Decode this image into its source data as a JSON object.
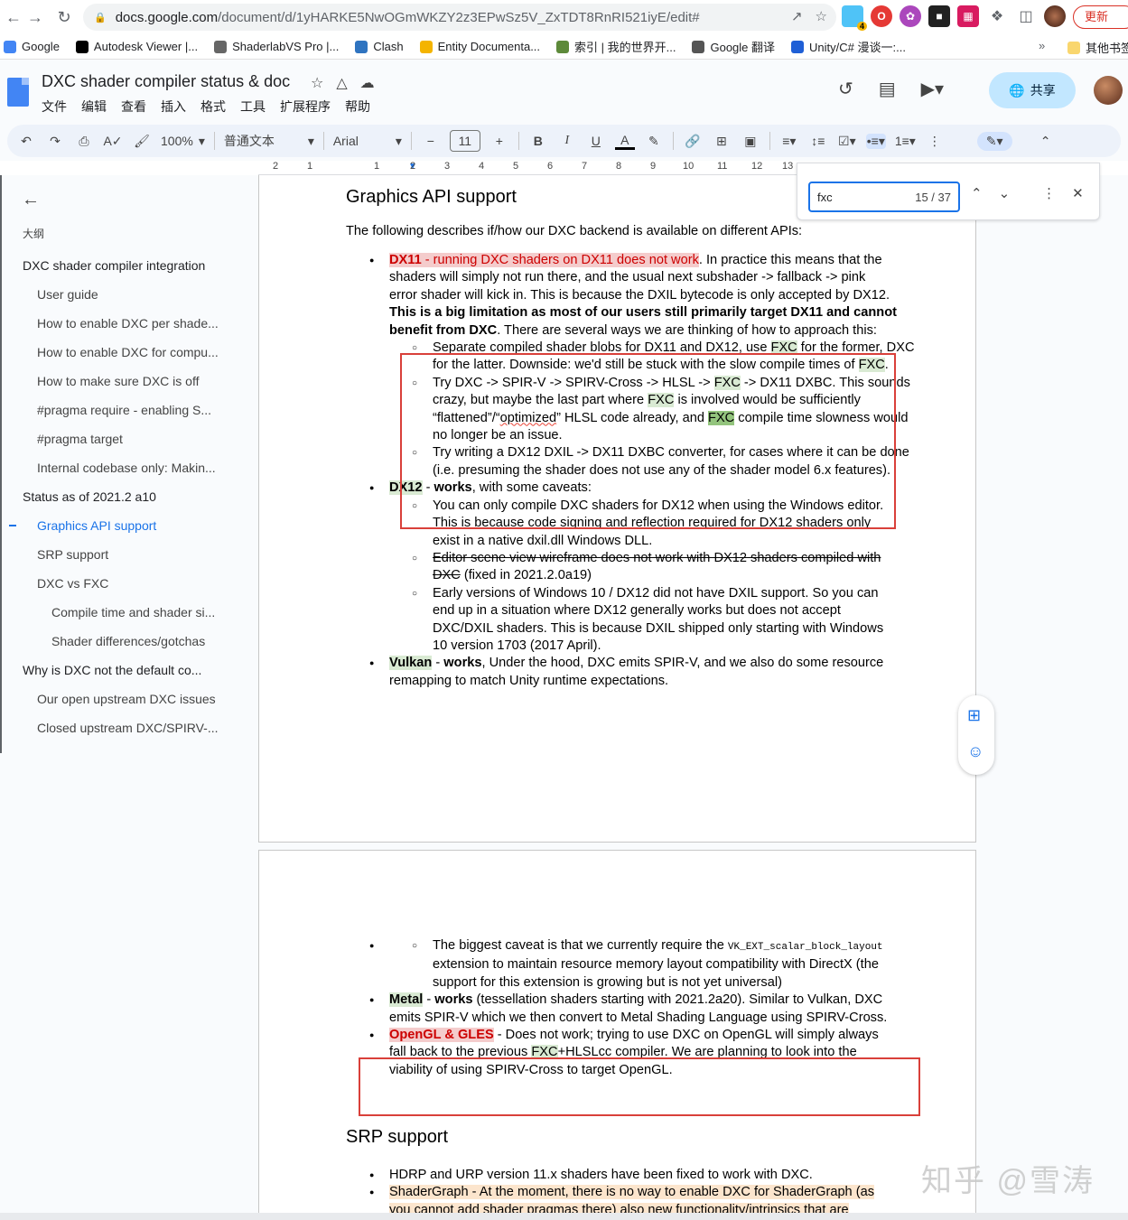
{
  "browser": {
    "url_host": "docs.google.com",
    "url_path": "/document/d/1yHARKE5NwOGmWKZY2z3EPwSz5V_ZxTDT8RnRI521iyE/edit#",
    "update_label": "更新",
    "ext_badge": "4"
  },
  "bookmarks": [
    {
      "label": "Google",
      "color": "#4285f4"
    },
    {
      "label": "Autodesk Viewer |...",
      "color": "#000000"
    },
    {
      "label": "ShaderlabVS Pro |...",
      "color": "#666666"
    },
    {
      "label": "Clash",
      "color": "#2f74c0"
    },
    {
      "label": "Entity Documenta...",
      "color": "#f4b400"
    },
    {
      "label": "索引 | 我的世界开...",
      "color": "#5d8a3a"
    },
    {
      "label": "Google 翻译",
      "color": "#555555"
    },
    {
      "label": "Unity/C# 漫谈一:...",
      "color": "#1f5fd6"
    }
  ],
  "bookmarks_more": "»",
  "bookmarks_other": "其他书签",
  "docs": {
    "title": "DXC shader compiler status & doc",
    "menu": [
      "文件",
      "编辑",
      "查看",
      "插入",
      "格式",
      "工具",
      "扩展程序",
      "帮助"
    ],
    "share_label": "共享"
  },
  "toolbar": {
    "zoom": "100%",
    "style": "普通文本",
    "font": "Arial",
    "font_size": "11"
  },
  "ruler_ticks": [
    "2",
    "1",
    "1",
    "2",
    "3",
    "4",
    "5",
    "6",
    "7",
    "8",
    "9",
    "10",
    "11",
    "12",
    "13"
  ],
  "outline": {
    "label": "大纲",
    "items": [
      {
        "text": "DXC shader compiler integration",
        "level": 1
      },
      {
        "text": "User guide",
        "level": 2
      },
      {
        "text": "How to enable DXC per shade...",
        "level": 2
      },
      {
        "text": "How to enable DXC for compu...",
        "level": 2
      },
      {
        "text": "How to make sure DXC is off",
        "level": 2
      },
      {
        "text": "#pragma require - enabling S...",
        "level": 2
      },
      {
        "text": "#pragma target",
        "level": 2
      },
      {
        "text": "Internal codebase only: Makin...",
        "level": 2
      },
      {
        "text": "Status as of 2021.2 a10",
        "level": 1
      },
      {
        "text": "Graphics API support",
        "level": 2,
        "active": true
      },
      {
        "text": "SRP support",
        "level": 2
      },
      {
        "text": "DXC vs FXC",
        "level": 2
      },
      {
        "text": "Compile time and shader si...",
        "level": 3
      },
      {
        "text": "Shader differences/gotchas",
        "level": 3
      },
      {
        "text": "Why is DXC not the default co...",
        "level": 1
      },
      {
        "text": "Our open upstream DXC issues",
        "level": 2
      },
      {
        "text": "Closed upstream DXC/SPIRV-...",
        "level": 2
      }
    ]
  },
  "find": {
    "query": "fxc",
    "count": "15 / 37"
  },
  "document": {
    "h_graphics": "Graphics API support",
    "intro": "The following describes if/how our DXC backend is available on different APIs:",
    "dx11_label": "DX11",
    "dx11_hl": " - running DXC shaders on DX11 does not work",
    "dx11_rest": ". In practice this means that the shaders will simply not run there, and the usual next subshader -> fallback -> pink error shader will kick in. This is because the DXIL bytecode is only accepted by DX12. ",
    "dx11_bold": "This is a big limitation as most of our users still primarily target DX11 and cannot benefit from DXC",
    "dx11_tail": ". There are several ways we are thinking of how to approach this:",
    "opt1_a": "Separate compiled shader blobs for DX11 and DX12, use ",
    "opt1_b": " for the former, DXC for the latter. Downside: we'd still be stuck with the slow compile times of ",
    "opt1_c": ".",
    "fxc": "FXC",
    "opt2_a": "Try DXC -> SPIR-V -> SPIRV-Cross -> HLSL -> ",
    "opt2_b": " -> DX11 DXBC. This sounds crazy, but maybe the last part where ",
    "opt2_c": " is involved would be sufficiently “flattened”/“",
    "opt2_optimized": "optimized",
    "opt2_d": "” HLSL code already, and ",
    "opt2_e": " compile time slowness would no longer be an issue.",
    "opt3": "Try writing a DX12 DXIL -> DX11 DXBC converter, for cases where it can be done (i.e. presuming the shader does not use any of the shader model 6.x features).",
    "dx12_label": "DX12",
    "dx12_sep": " - ",
    "works": "works",
    "dx12_rest": ", with some caveats:",
    "dx12_c1": "You can only compile DXC shaders for DX12 when using the Windows editor. This is because code signing and reflection required for DX12 shaders only exist in a native dxil.dll Windows DLL.",
    "dx12_c2_strike": "Editor scene view wireframe does not work with DX12 shaders compiled with DXC",
    "dx12_c2_rest": " (fixed in 2021.2.0a19)",
    "dx12_c3": "Early versions of Windows 10 / DX12 did not have DXIL support. So you can end up in a situation where DX12 generally works but does not accept DXC/DXIL shaders. This is because DXIL shipped only starting with Windows 10 version 1703 (2017 April).",
    "vulkan_label": "Vulkan",
    "vulkan_rest": ", Under the hood, DXC emits SPIR-V, and we also do some resource remapping to match Unity runtime expectations.",
    "vk_c1_a": "The biggest caveat is that we currently require the ",
    "vk_c1_mono": "VK_EXT_scalar_block_layout",
    "vk_c1_b": " extension to maintain resource memory layout compatibility with DirectX (the support for this extension is growing but is not yet universal)",
    "metal_label": "Metal",
    "metal_rest": " (tessellation shaders starting with 2021.2a20). Similar to Vulkan, DXC emits SPIR-V which we then convert to Metal Shading Language using SPIRV-Cross.",
    "gl_label": "OpenGL & GLES",
    "gl_a": " - Does not work; trying to use DXC on OpenGL will simply always fall back to the previous ",
    "gl_b": "+HLSLcc compiler. We are planning to look into the viability of using SPIRV-Cross to target OpenGL.",
    "h_srp": "SRP support",
    "srp1": "HDRP and URP version 11.x shaders have been fixed to work with DXC.",
    "srp2": "ShaderGraph - At the moment, there is no way to enable DXC for ShaderGraph (as you cannot add shader pragmas there) also new functionality/intrinsics that are"
  },
  "watermark": "知乎 @雪涛"
}
